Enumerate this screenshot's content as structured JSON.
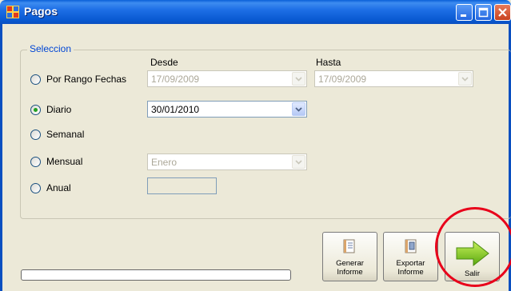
{
  "window": {
    "title": "Pagos",
    "icon": "app-window-icon",
    "controls": [
      "minimize-icon",
      "maximize-icon",
      "close-icon"
    ]
  },
  "seleccion": {
    "legend": "Seleccion",
    "desde_label": "Desde",
    "hasta_label": "Hasta",
    "options": [
      {
        "label": "Por Rango Fechas",
        "checked": false
      },
      {
        "label": "Diario",
        "checked": true
      },
      {
        "label": "Semanal",
        "checked": false
      },
      {
        "label": "Mensual",
        "checked": false
      },
      {
        "label": "Anual",
        "checked": false
      }
    ],
    "desde_value": "17/09/2009",
    "hasta_value": "17/09/2009",
    "diario_value": "30/01/2010",
    "mensual_value": "Enero",
    "anual_value": ""
  },
  "buttons": {
    "generar": "Generar Informe",
    "generar_l1": "Generar",
    "generar_l2": "Informe",
    "exportar_l1": "Exportar",
    "exportar_l2": "Informe",
    "salir": "Salir"
  },
  "colors": {
    "titlebar": "#0858d0",
    "window_bg": "#ece9d8",
    "legend_text": "#0046d5",
    "highlight": "#e8001a",
    "arrow_green": "#6dbb1c"
  }
}
